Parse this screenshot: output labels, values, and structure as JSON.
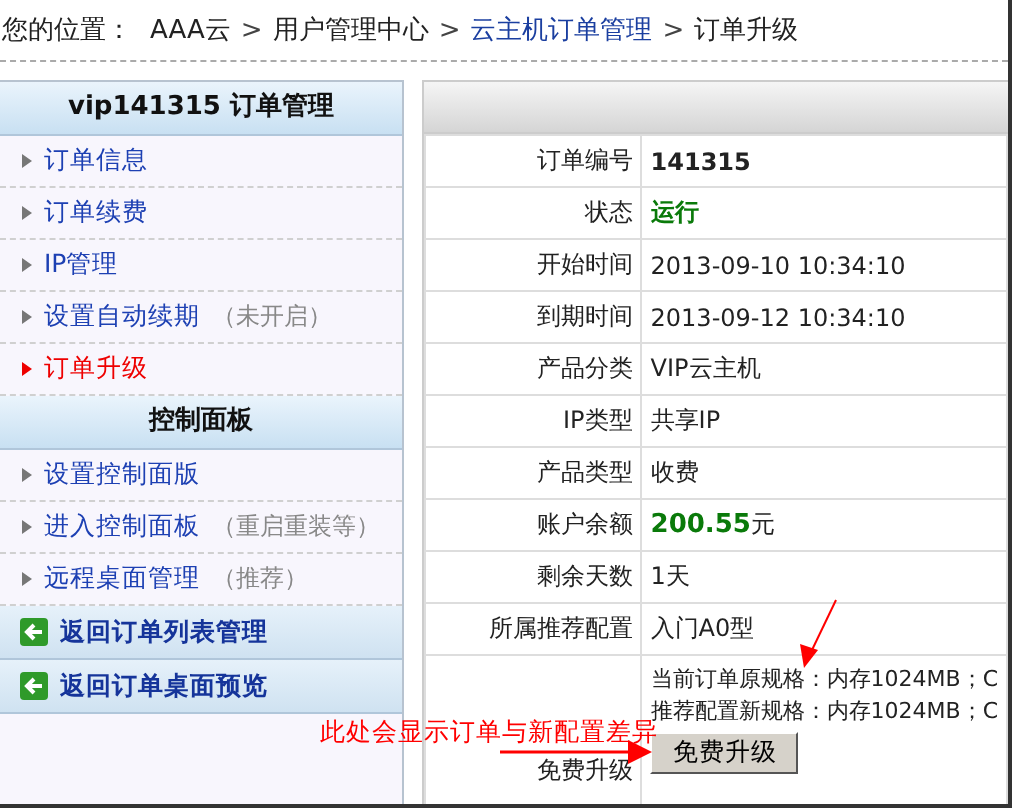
{
  "breadcrumb": {
    "label": "您的位置：",
    "items": [
      {
        "kind": "crumb",
        "text": "AAA云",
        "link": false
      },
      {
        "kind": "sep",
        "text": ">"
      },
      {
        "kind": "crumb",
        "text": "用户管理中心",
        "link": false
      },
      {
        "kind": "sep",
        "text": ">"
      },
      {
        "kind": "crumb",
        "text": "云主机订单管理",
        "link": true
      },
      {
        "kind": "sep",
        "text": ">"
      },
      {
        "kind": "crumb",
        "text": "订单升级",
        "link": false
      }
    ]
  },
  "sidebar": {
    "sections": [
      {
        "title": "vip141315 订单管理",
        "items": [
          {
            "label": "订单信息",
            "selected": false
          },
          {
            "label": "订单续费",
            "selected": false
          },
          {
            "label": "IP管理",
            "selected": false
          },
          {
            "label": "设置自动续期",
            "note": "（未开启）",
            "selected": false
          },
          {
            "label": "订单升级",
            "selected": true
          }
        ]
      },
      {
        "title": "控制面板",
        "items": [
          {
            "label": "设置控制面版",
            "selected": false
          },
          {
            "label": "进入控制面板",
            "note": "（重启重装等）",
            "selected": false
          },
          {
            "label": "远程桌面管理",
            "note": "（推荐）",
            "selected": false
          }
        ]
      }
    ],
    "back_links": [
      "返回订单列表管理",
      "返回订单桌面预览"
    ]
  },
  "order_table": {
    "rows": [
      {
        "kind": "bold",
        "label": "订单编号",
        "value": "141315"
      },
      {
        "kind": "status",
        "label": "状态",
        "value": "运行"
      },
      {
        "kind": "plain",
        "label": "开始时间",
        "value": "2013-09-10 10:34:10"
      },
      {
        "kind": "plain",
        "label": "到期时间",
        "value": "2013-09-12 10:34:10"
      },
      {
        "kind": "plain",
        "label": "产品分类",
        "value": "VIP云主机"
      },
      {
        "kind": "plain",
        "label": "IP类型",
        "value": "共享IP"
      },
      {
        "kind": "plain",
        "label": "产品类型",
        "value": "收费"
      },
      {
        "kind": "money",
        "label": "账户余额",
        "value": "200.55",
        "unit": "元"
      },
      {
        "kind": "plain",
        "label": "剩余天数",
        "value": "1天"
      },
      {
        "kind": "plain",
        "label": "所属推荐配置",
        "value": "入门A0型"
      }
    ],
    "upgrade": {
      "label": "免费升级",
      "specs": [
        "当前订单原规格：内存1024MB；C",
        "推荐配置新规格：内存1024MB；C"
      ],
      "button": "免费升级"
    }
  },
  "annotation": {
    "text": "此处会显示订单与新配置差异"
  }
}
